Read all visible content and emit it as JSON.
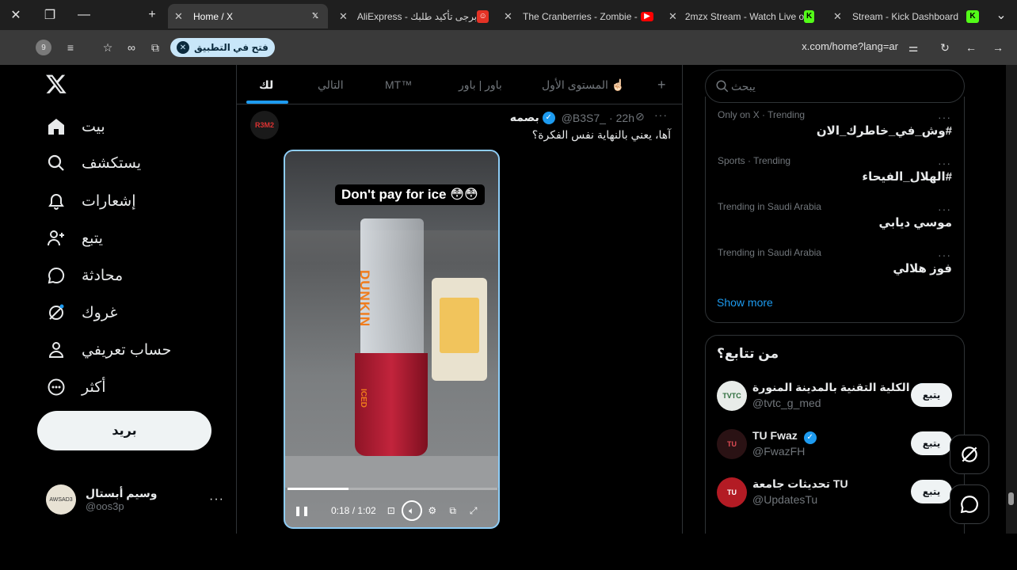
{
  "browser": {
    "tabs": [
      {
        "title": "Home / X",
        "active": true,
        "favicon": "x-logo",
        "favicon_color": "#ffffff"
      },
      {
        "title": "AliExpress - برجى تأكيد طلبك",
        "favicon": "aliexpress",
        "favicon_color": "#e43225"
      },
      {
        "title": "The Cranberries - Zombie -",
        "favicon": "youtube",
        "favicon_color": "#ff0000"
      },
      {
        "title": "2mzx Stream - Watch Live o",
        "favicon": "kick",
        "favicon_color": "#53fc18"
      },
      {
        "title": "Stream - Kick Dashboard",
        "favicon": "kick",
        "favicon_color": "#53fc18"
      }
    ],
    "open_in_app": "فتح في التطبيق",
    "url": "x.com/home?lang=ar",
    "profile_badge": "9"
  },
  "nav": {
    "items": [
      {
        "label": "بيت",
        "icon": "home-icon"
      },
      {
        "label": "يستكشف",
        "icon": "search-icon"
      },
      {
        "label": "إشعارات",
        "icon": "bell-icon"
      },
      {
        "label": "يتبع",
        "icon": "person-add-icon"
      },
      {
        "label": "محادثة",
        "icon": "chat-icon"
      },
      {
        "label": "غروك",
        "icon": "grok-icon"
      },
      {
        "label": "حساب تعريفي",
        "icon": "profile-icon"
      },
      {
        "label": "أكثر",
        "icon": "more-circle-icon"
      }
    ],
    "post_button": "بريد",
    "profile": {
      "name": "وسيم أبستال",
      "handle": "@oos3p",
      "avatar_text": "AWSAD3"
    }
  },
  "timeline": {
    "tabs": [
      "لك",
      "التالي",
      "MT™",
      "باور | باور",
      "المستوى الأول ☝🏻"
    ],
    "add_tab": "+",
    "tweet": {
      "avatar_text": "R3M2",
      "name": "بصمه",
      "handle": "@B3S7_",
      "time": "22h",
      "text": "آها، يعني بالنهاية نفس الفكرة؟",
      "video": {
        "caption": "Don't pay for ice 😳😳",
        "time_display": "0:18 / 1:02",
        "progress": 0.29,
        "cup_brand": "DUNKIN",
        "cup_label": "ICED"
      }
    }
  },
  "sidebar": {
    "search_placeholder": "يبحث",
    "trends": [
      {
        "meta": "Only on X · Trending",
        "title": "#وش_في_خاطرك_الان"
      },
      {
        "meta": "Sports · Trending",
        "title": "#الهلال_الفيحاء"
      },
      {
        "meta": "Trending in Saudi Arabia",
        "title": "موسي ديابي"
      },
      {
        "meta": "Trending in Saudi Arabia",
        "title": "فوز هلالي"
      }
    ],
    "show_more": "Show more",
    "who_to_follow": {
      "title": "من تتابع؟",
      "accounts": [
        {
          "name": "الكلية التقنية بالمدينة المنورة",
          "handle": "@tvtc_g_med",
          "verified": true,
          "follow": "يتبع",
          "avatar_color": "#e8ece9",
          "avatar_text": "TVTC"
        },
        {
          "name": "TU Fwaz",
          "handle": "@FwazFH",
          "verified": true,
          "follow": "يتبع",
          "avatar_color": "#2a1214",
          "avatar_text": "TU"
        },
        {
          "name": "تحديثات جامعة TU",
          "handle": "@UpdatesTu",
          "verified": false,
          "follow": "يتبع",
          "avatar_color": "#b31b24",
          "avatar_text": "TU"
        }
      ]
    }
  },
  "colors": {
    "accent": "#1d9bf0",
    "background": "#000000",
    "border": "#2f3336",
    "muted": "#71767b"
  }
}
